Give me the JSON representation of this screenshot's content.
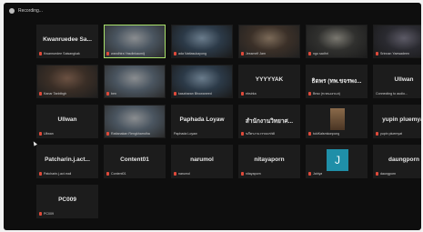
{
  "topbar": {
    "status": "Recording..."
  },
  "tiles": [
    {
      "center": "Kwanruedee Sa...",
      "label": "Kwanruedee Saisangkak",
      "type": "name"
    },
    {
      "center": "",
      "label": "wandhira Yasdinkaumiji",
      "type": "video",
      "speaking": true
    },
    {
      "center": "",
      "label": "ada Nattasukayong",
      "type": "video"
    },
    {
      "center": "",
      "label": "Jessmelf Jam",
      "type": "video"
    },
    {
      "center": "",
      "label": "ngo sadhri",
      "type": "video"
    },
    {
      "center": "",
      "label": "Srinnan Yaewadeen",
      "type": "video"
    },
    {
      "center": "",
      "label": "Kanar Tanblbgh",
      "type": "video"
    },
    {
      "center": "",
      "label": "ben",
      "type": "video"
    },
    {
      "center": "",
      "label": "kasaharan Bhowaneed",
      "type": "video"
    },
    {
      "center": "YYYYYAK",
      "label": "ebsirka",
      "type": "name"
    },
    {
      "center": "ธิดพร (ทพ.ขจรพง...",
      "label": "Bnsc (ท.ทนองรแส)",
      "type": "name"
    },
    {
      "center": "Ullwan",
      "label": "Connecting to audio...",
      "type": "name",
      "nomic": true
    },
    {
      "center": "Ullwan",
      "label": "Ullwan",
      "type": "name"
    },
    {
      "center": "",
      "label": "Rattanakan Rengkhamdha",
      "type": "video"
    },
    {
      "center": "Paphada Loyaw",
      "label": "Paphada Loyaw",
      "type": "name",
      "nomic": true
    },
    {
      "center": "สำนักงานวิทยาศ...",
      "label": "ขภีตรงานวรรธดรhill",
      "type": "name"
    },
    {
      "center": "",
      "label": "tukiKalsmkonpong",
      "type": "photo"
    },
    {
      "center": "yupin pluemyat",
      "label": "yupin pluemyat",
      "type": "name"
    },
    {
      "center": "Patcharin.j.act...",
      "label": "Patcharin.j.act.mail",
      "type": "name"
    },
    {
      "center": "Content01",
      "label": "Content01",
      "type": "name"
    },
    {
      "center": "narumol",
      "label": "narumol",
      "type": "name"
    },
    {
      "center": "nitayaporn",
      "label": "nitayaporn",
      "type": "name"
    },
    {
      "center": "J",
      "label": "Jahiya",
      "type": "avatar"
    },
    {
      "center": "daungporn",
      "label": "daungporn",
      "type": "name"
    },
    {
      "center": "PC009",
      "label": "PC009",
      "type": "name"
    }
  ],
  "colors": {
    "mic_muted": "#e04a3a",
    "speaking_border": "#a8e06a",
    "avatar_bg": "#1f8fa8"
  }
}
